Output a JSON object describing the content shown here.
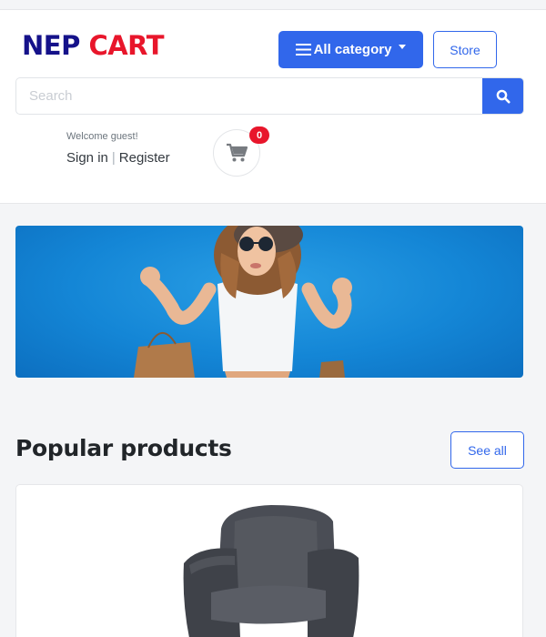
{
  "brand": {
    "word1": "NEP",
    "word2": "CART",
    "color1": "#15128a",
    "color2": "#e8162b"
  },
  "header": {
    "category_button": {
      "label": "All category",
      "icon": "menu-icon"
    },
    "store_button": {
      "label": "Store"
    },
    "search": {
      "placeholder": "Search",
      "value": "",
      "icon": "search-icon"
    },
    "account": {
      "welcome": "Welcome guest!",
      "sign_in": "Sign in",
      "separator": "|",
      "register": "Register"
    },
    "cart": {
      "icon": "cart-icon",
      "count": "0"
    }
  },
  "banner": {
    "image": "woman-with-shopping-bags"
  },
  "popular": {
    "title": "Popular products",
    "see_all_label": "See all",
    "products": [
      {
        "image": "armchair"
      }
    ]
  },
  "colors": {
    "primary": "#3167eb",
    "badge": "#e8162b",
    "background": "#f4f5f7"
  }
}
